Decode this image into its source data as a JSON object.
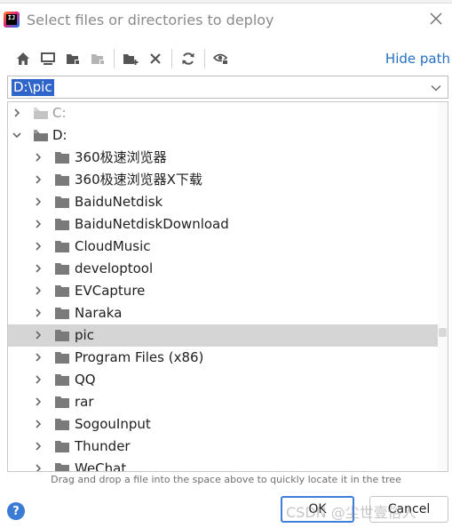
{
  "dialog": {
    "title": "Select files or directories to deploy",
    "app_logo_text": "IJ"
  },
  "toolbar": {
    "buttons": [
      {
        "icon": "home-icon"
      },
      {
        "icon": "desktop-icon"
      },
      {
        "icon": "project-folder-icon"
      },
      {
        "icon": "module-folder-icon"
      },
      {
        "icon": "new-folder-icon"
      },
      {
        "icon": "delete-icon"
      },
      {
        "icon": "refresh-icon"
      },
      {
        "icon": "show-hidden-icon"
      }
    ],
    "hide_path_label": "Hide path"
  },
  "path": {
    "value": "D:\\pic"
  },
  "tree": {
    "rows": [
      {
        "label": "C:",
        "level": 0,
        "expanded": false,
        "type": "drive",
        "dim": true
      },
      {
        "label": "D:",
        "level": 0,
        "expanded": true,
        "type": "drive"
      },
      {
        "label": "360极速浏览器",
        "level": 1,
        "type": "folder"
      },
      {
        "label": "360极速浏览器X下载",
        "level": 1,
        "type": "folder"
      },
      {
        "label": "BaiduNetdisk",
        "level": 1,
        "type": "folder"
      },
      {
        "label": "BaiduNetdiskDownload",
        "level": 1,
        "type": "folder"
      },
      {
        "label": "CloudMusic",
        "level": 1,
        "type": "folder"
      },
      {
        "label": "developtool",
        "level": 1,
        "type": "folder"
      },
      {
        "label": "EVCapture",
        "level": 1,
        "type": "folder"
      },
      {
        "label": "Naraka",
        "level": 1,
        "type": "folder"
      },
      {
        "label": "pic",
        "level": 1,
        "type": "folder",
        "selected": true
      },
      {
        "label": "Program Files (x86)",
        "level": 1,
        "type": "folder"
      },
      {
        "label": "QQ",
        "level": 1,
        "type": "folder"
      },
      {
        "label": "rar",
        "level": 1,
        "type": "folder"
      },
      {
        "label": "SogouInput",
        "level": 1,
        "type": "folder"
      },
      {
        "label": "Thunder",
        "level": 1,
        "type": "folder"
      },
      {
        "label": "WeChat",
        "level": 1,
        "type": "folder"
      }
    ]
  },
  "hint": "Drag and drop a file into the space above to quickly locate it in the tree",
  "footer": {
    "help_label": "?",
    "ok_label": "OK",
    "cancel_label": "Cancel",
    "watermark": "CSDN @尘世壹俗人"
  },
  "colors": {
    "accent": "#2f65ca",
    "link": "#2470c4",
    "selection_row": "#d5d5d5",
    "folder": "#7a7a7a"
  }
}
